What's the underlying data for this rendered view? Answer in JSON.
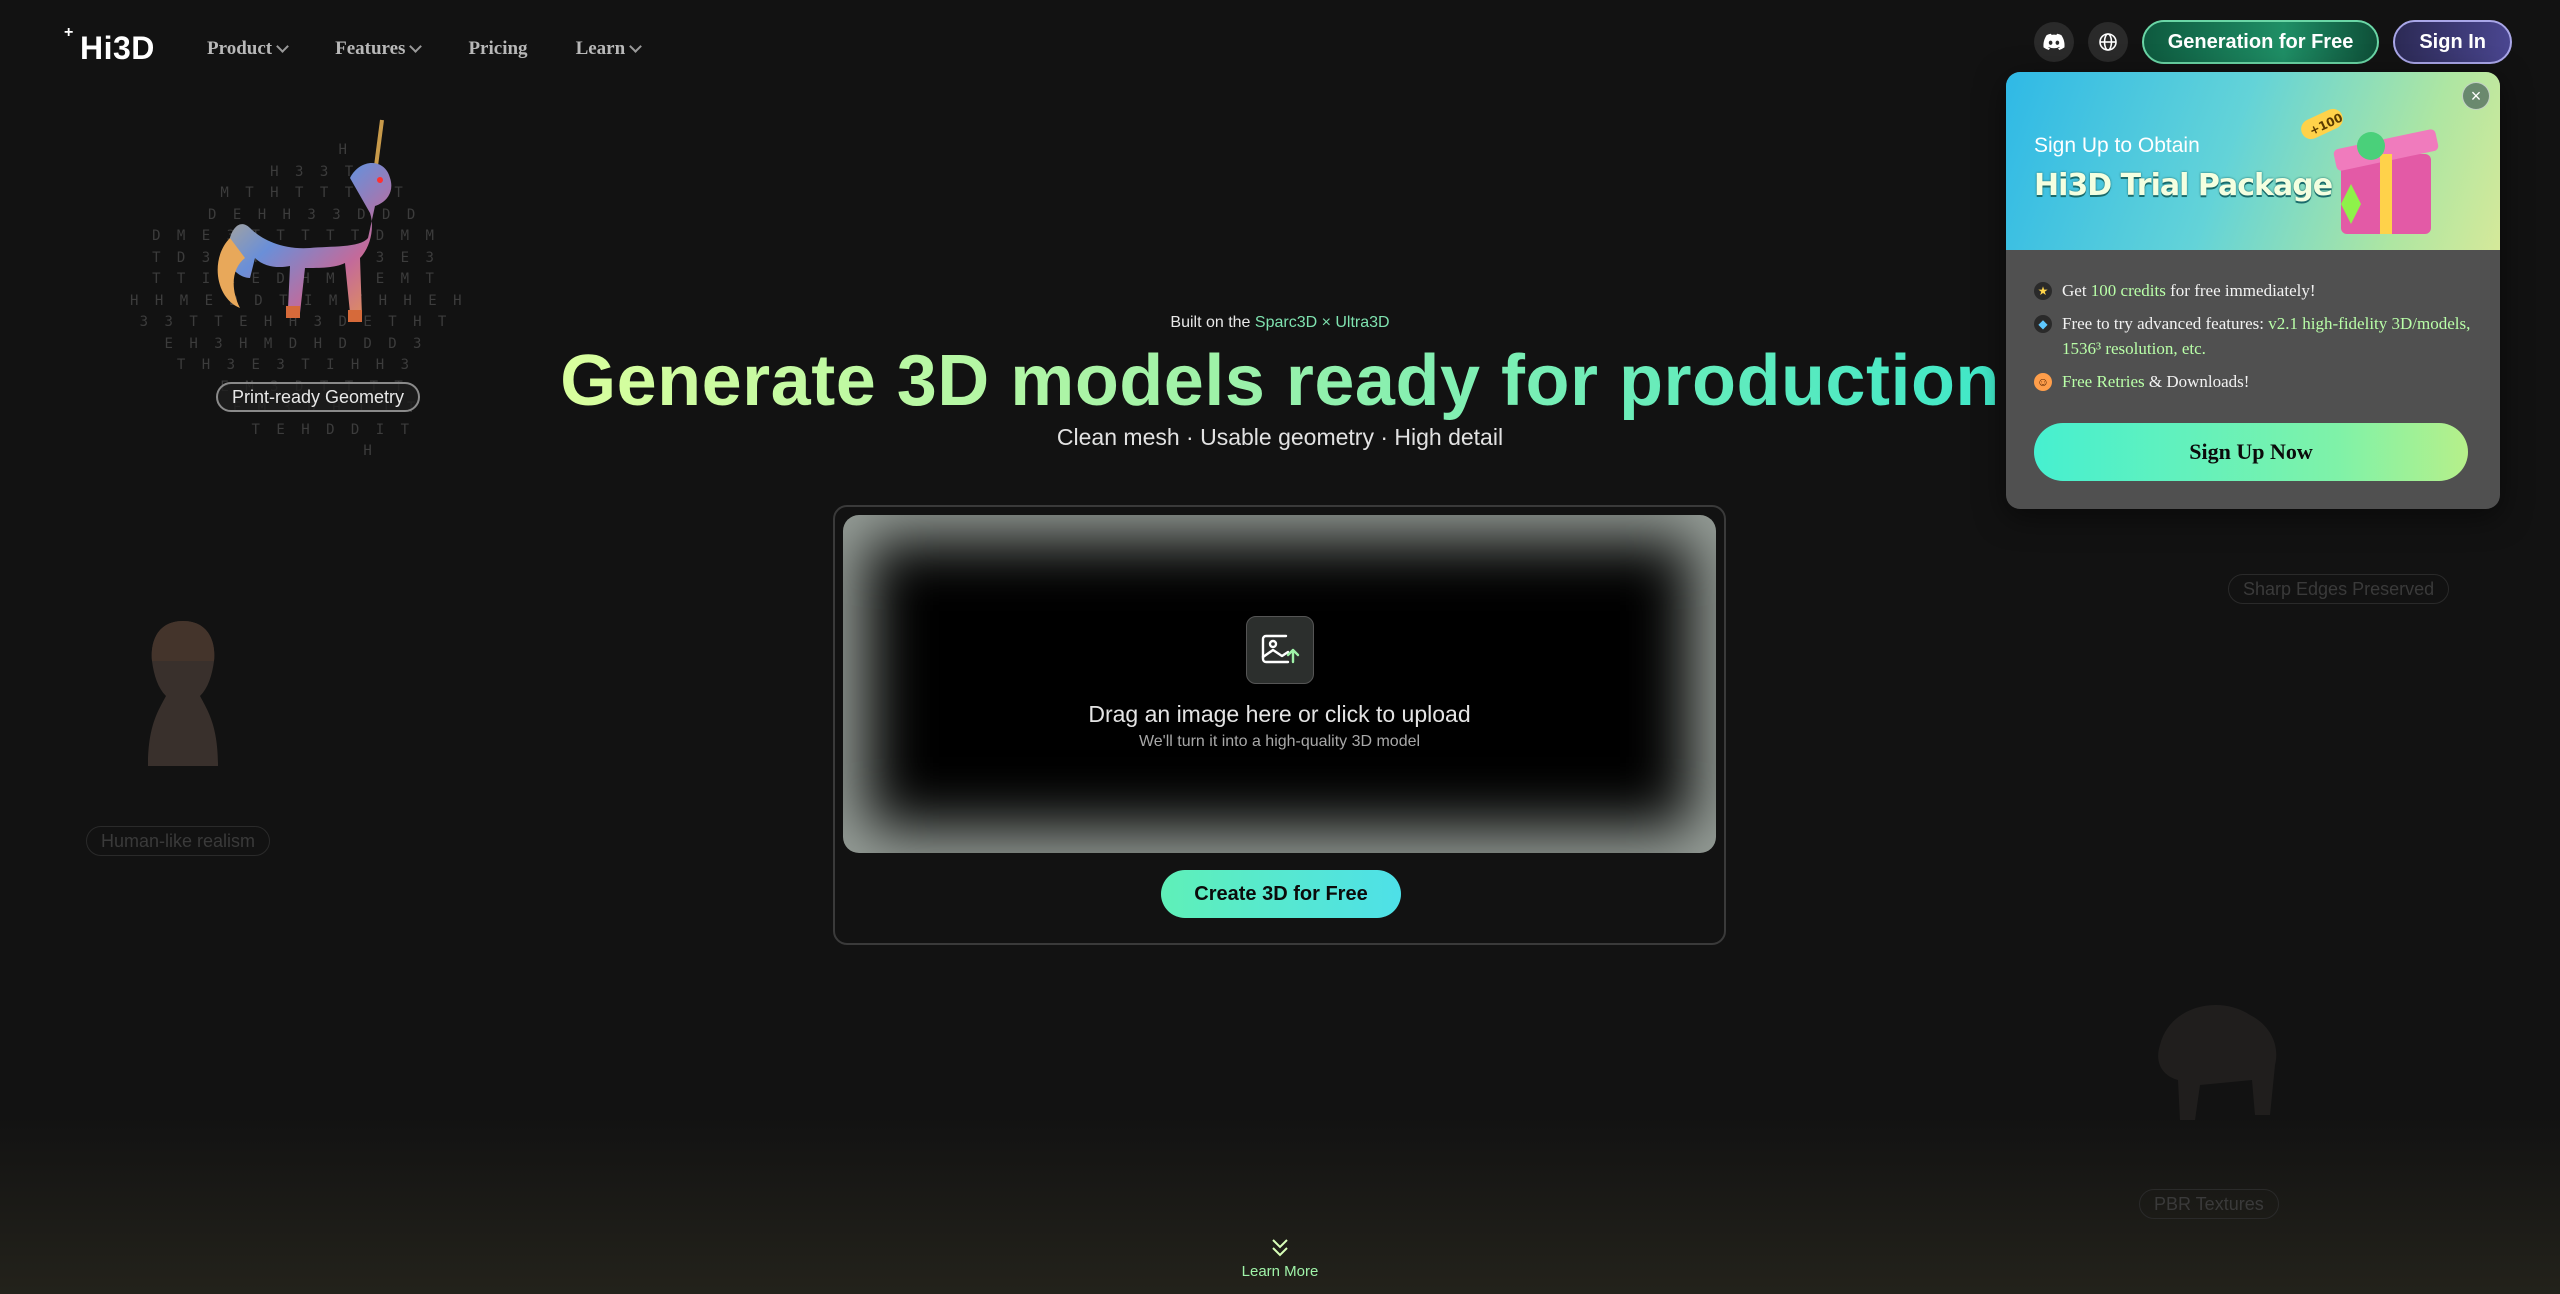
{
  "brand": {
    "logo_spark": "+",
    "logo_text": "Hi3D"
  },
  "nav": {
    "product": "Product",
    "features": "Features",
    "pricing": "Pricing",
    "learn": "Learn"
  },
  "header_actions": {
    "discord_icon": "discord-icon",
    "language_icon": "globe-icon",
    "generate_label": "Generation for Free",
    "signin_label": "Sign In"
  },
  "hero": {
    "built_prefix": "Built on the ",
    "built_accent": "Sparc3D × Ultra3D",
    "headline": "Generate 3D models ready for production",
    "subline": "Clean mesh · Usable geometry · High detail"
  },
  "upload": {
    "icon": "image-upload-icon",
    "title": "Drag an image here or click to upload",
    "subtitle": "We'll turn it into a high-quality 3D model",
    "button": "Create 3D for Free"
  },
  "showcase": {
    "matrix_text": "        H\n     H 3 3 T T\n   M T H T T T T T\n   D E H H 3 3 D D D\nD M E 3 T T T T T D M M\nT D 3 3 T D M D E 3 E 3\nT T I E E D H M 3 E M T\nH H M E D D T I M T H H E H\n3 3 T T E H H 3 D E T H T\nE H 3 H M D H D D D 3\nT H 3 E 3 T I H H 3\n   E M 3 D T T T T\n     E M 3 D H T T T\n      T E H D D I T\n            H",
    "print_ready": "Print-ready Geometry",
    "human_like": "Human-like realism",
    "sharp_edges": "Sharp Edges Preserved",
    "pbr": "PBR Textures"
  },
  "learn_more": "Learn More",
  "popup": {
    "kicker": "Sign Up to Obtain",
    "title": "Hi3D Trial Package",
    "badge": "+100",
    "items": {
      "i1_a": "Get ",
      "i1_hl": "100 credits",
      "i1_b": " for free immediately!",
      "i2_a": "Free to try advanced features: ",
      "i2_hl": "v2.1 high-fidelity 3D/models, 1536³ resolution, etc.",
      "i3_hl": "Free Retries",
      "i3_b": " & Downloads!"
    },
    "cta": "Sign Up Now",
    "close": "×"
  },
  "colors": {
    "background": "#121212",
    "accent_green": "#7fe3b0",
    "accent_cyan": "#4ee0e8"
  }
}
